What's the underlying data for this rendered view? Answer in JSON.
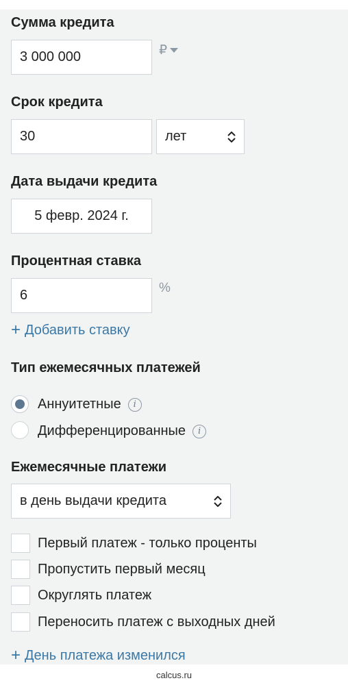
{
  "loan_amount": {
    "label": "Сумма кредита",
    "value": "3 000 000",
    "currency": "₽"
  },
  "term": {
    "label": "Срок кредита",
    "value": "30",
    "unit": "лет"
  },
  "issue_date": {
    "label": "Дата выдачи кредита",
    "value": "5 февр. 2024 г."
  },
  "rate": {
    "label": "Процентная ставка",
    "value": "6",
    "unit": "%",
    "add_link": "Добавить ставку"
  },
  "payment_type": {
    "label": "Тип ежемесячных платежей",
    "options": [
      {
        "label": "Аннуитетные",
        "selected": true
      },
      {
        "label": "Дифференцированные",
        "selected": false
      }
    ],
    "info_glyph": "i"
  },
  "monthly": {
    "label": "Ежемесячные платежи",
    "select_value": "в день выдачи кредита",
    "checkboxes": [
      {
        "label": "Первый платеж - только проценты",
        "checked": false
      },
      {
        "label": "Пропустить первый месяц",
        "checked": false
      },
      {
        "label": "Округлять платеж",
        "checked": false
      },
      {
        "label": "Переносить платеж с выходных дней",
        "checked": false
      }
    ],
    "change_link": "День платежа изменился"
  },
  "plus_glyph": "+",
  "footer": {
    "domain": "calcus.ru"
  },
  "colors": {
    "panel_bg": "#f2f4f4",
    "link": "#3b78a6",
    "radio_selected": "#5f7891",
    "border": "#cfd5d9"
  },
  "icons": [
    "ruble-dropdown-icon",
    "chevron-updown-icon",
    "info-icon",
    "plus-icon"
  ]
}
